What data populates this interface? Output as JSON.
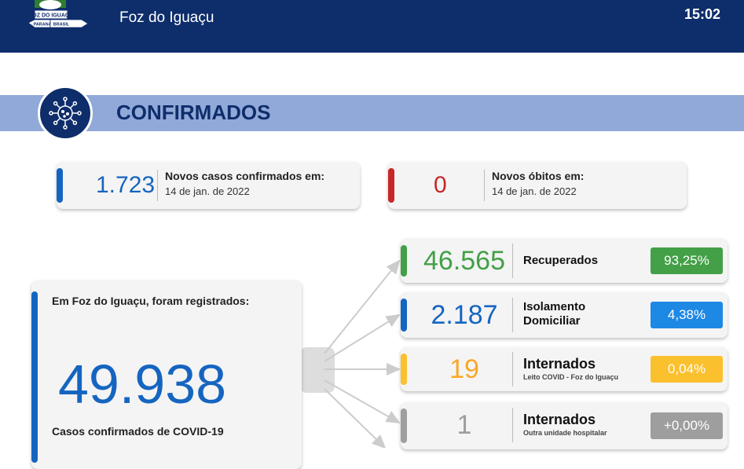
{
  "header": {
    "city": "Foz do Iguaçu",
    "time": "15:02",
    "logo_text_1": "FOZ DO IGUAÇU",
    "logo_text_2": "PARANÁ",
    "logo_text_3": "BRASIL"
  },
  "section": {
    "title": "CONFIRMADOS",
    "icon": "virus-icon"
  },
  "new_cases": {
    "value": "1.723",
    "title": "Novos casos confirmados em:",
    "date": "14 de jan. de 2022",
    "color": "#1565c0"
  },
  "new_deaths": {
    "value": "0",
    "title": "Novos óbitos em:",
    "date": "14 de jan. de 2022",
    "color": "#c62828"
  },
  "total": {
    "heading": "Em Foz do Iguaçu, foram registrados:",
    "value": "49.938",
    "caption": "Casos confirmados de COVID-19"
  },
  "breakdown": [
    {
      "value": "46.565",
      "label": "Recuperados",
      "sublabel": "",
      "pct": "93,25%",
      "color": "#43a047"
    },
    {
      "value": "2.187",
      "label": "Isolamento Domiciliar",
      "sublabel": "",
      "pct": "4,38%",
      "color": "#1e88e5"
    },
    {
      "value": "19",
      "label": "Internados",
      "sublabel": "Leito COVID - Foz do Iguaçu",
      "pct": "0,04%",
      "color": "#fbc02d"
    },
    {
      "value": "1",
      "label": "Internados",
      "sublabel": "Outra unidade hospitalar",
      "pct": "+0,00%",
      "color": "#9e9e9e"
    }
  ]
}
